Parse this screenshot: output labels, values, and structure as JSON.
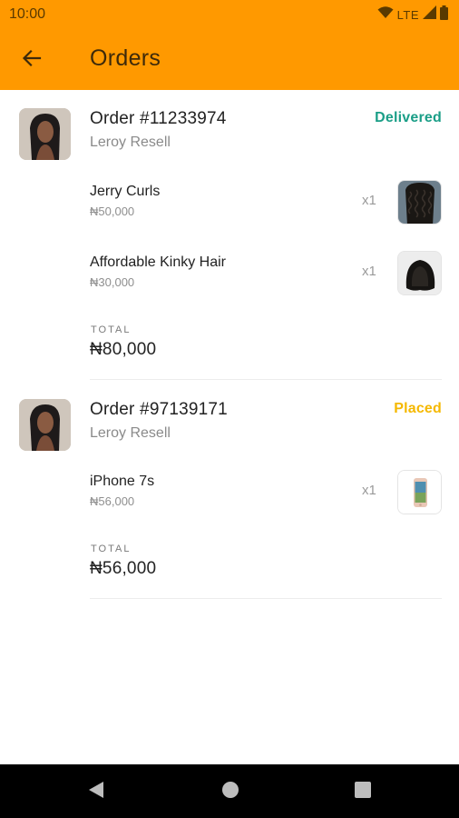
{
  "status_bar": {
    "time": "10:00",
    "network": "LTE",
    "icons": [
      "wifi-icon",
      "signal-icon",
      "battery-icon"
    ]
  },
  "app_bar": {
    "title": "Orders",
    "back_icon": "arrow-left-icon",
    "color": "#ff9900"
  },
  "orders": [
    {
      "number": "Order #11233974",
      "seller": "Leroy Resell",
      "status": "Delivered",
      "status_color": "#1a9e87",
      "items": [
        {
          "name": "Jerry Curls",
          "price": "₦50,000",
          "qty": "x1",
          "thumb": "curly-hair-image"
        },
        {
          "name": "Affordable Kinky Hair",
          "price": "₦30,000",
          "qty": "x1",
          "thumb": "bob-wig-image"
        }
      ],
      "total_label": "TOTAL",
      "total": "₦80,000"
    },
    {
      "number": "Order #97139171",
      "seller": "Leroy Resell",
      "status": "Placed",
      "status_color": "#f5b800",
      "items": [
        {
          "name": "iPhone 7s",
          "price": "₦56,000",
          "qty": "x1",
          "thumb": "phone-image"
        }
      ],
      "total_label": "TOTAL",
      "total": "₦56,000"
    }
  ],
  "nav_bar": {
    "buttons": [
      "back-triangle-icon",
      "home-circle-icon",
      "recents-square-icon"
    ]
  }
}
